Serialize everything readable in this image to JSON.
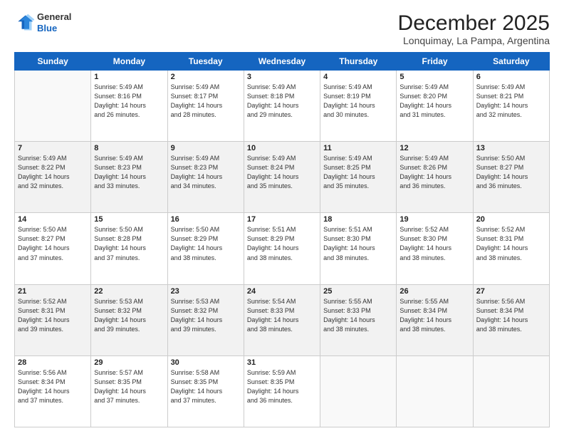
{
  "header": {
    "logo_line1": "General",
    "logo_line2": "Blue",
    "month_title": "December 2025",
    "location": "Lonquimay, La Pampa, Argentina"
  },
  "days_of_week": [
    "Sunday",
    "Monday",
    "Tuesday",
    "Wednesday",
    "Thursday",
    "Friday",
    "Saturday"
  ],
  "weeks": [
    [
      {
        "day": "",
        "info": ""
      },
      {
        "day": "1",
        "info": "Sunrise: 5:49 AM\nSunset: 8:16 PM\nDaylight: 14 hours\nand 26 minutes."
      },
      {
        "day": "2",
        "info": "Sunrise: 5:49 AM\nSunset: 8:17 PM\nDaylight: 14 hours\nand 28 minutes."
      },
      {
        "day": "3",
        "info": "Sunrise: 5:49 AM\nSunset: 8:18 PM\nDaylight: 14 hours\nand 29 minutes."
      },
      {
        "day": "4",
        "info": "Sunrise: 5:49 AM\nSunset: 8:19 PM\nDaylight: 14 hours\nand 30 minutes."
      },
      {
        "day": "5",
        "info": "Sunrise: 5:49 AM\nSunset: 8:20 PM\nDaylight: 14 hours\nand 31 minutes."
      },
      {
        "day": "6",
        "info": "Sunrise: 5:49 AM\nSunset: 8:21 PM\nDaylight: 14 hours\nand 32 minutes."
      }
    ],
    [
      {
        "day": "7",
        "info": "Sunrise: 5:49 AM\nSunset: 8:22 PM\nDaylight: 14 hours\nand 32 minutes."
      },
      {
        "day": "8",
        "info": "Sunrise: 5:49 AM\nSunset: 8:23 PM\nDaylight: 14 hours\nand 33 minutes."
      },
      {
        "day": "9",
        "info": "Sunrise: 5:49 AM\nSunset: 8:23 PM\nDaylight: 14 hours\nand 34 minutes."
      },
      {
        "day": "10",
        "info": "Sunrise: 5:49 AM\nSunset: 8:24 PM\nDaylight: 14 hours\nand 35 minutes."
      },
      {
        "day": "11",
        "info": "Sunrise: 5:49 AM\nSunset: 8:25 PM\nDaylight: 14 hours\nand 35 minutes."
      },
      {
        "day": "12",
        "info": "Sunrise: 5:49 AM\nSunset: 8:26 PM\nDaylight: 14 hours\nand 36 minutes."
      },
      {
        "day": "13",
        "info": "Sunrise: 5:50 AM\nSunset: 8:27 PM\nDaylight: 14 hours\nand 36 minutes."
      }
    ],
    [
      {
        "day": "14",
        "info": "Sunrise: 5:50 AM\nSunset: 8:27 PM\nDaylight: 14 hours\nand 37 minutes."
      },
      {
        "day": "15",
        "info": "Sunrise: 5:50 AM\nSunset: 8:28 PM\nDaylight: 14 hours\nand 37 minutes."
      },
      {
        "day": "16",
        "info": "Sunrise: 5:50 AM\nSunset: 8:29 PM\nDaylight: 14 hours\nand 38 minutes."
      },
      {
        "day": "17",
        "info": "Sunrise: 5:51 AM\nSunset: 8:29 PM\nDaylight: 14 hours\nand 38 minutes."
      },
      {
        "day": "18",
        "info": "Sunrise: 5:51 AM\nSunset: 8:30 PM\nDaylight: 14 hours\nand 38 minutes."
      },
      {
        "day": "19",
        "info": "Sunrise: 5:52 AM\nSunset: 8:30 PM\nDaylight: 14 hours\nand 38 minutes."
      },
      {
        "day": "20",
        "info": "Sunrise: 5:52 AM\nSunset: 8:31 PM\nDaylight: 14 hours\nand 38 minutes."
      }
    ],
    [
      {
        "day": "21",
        "info": "Sunrise: 5:52 AM\nSunset: 8:31 PM\nDaylight: 14 hours\nand 39 minutes."
      },
      {
        "day": "22",
        "info": "Sunrise: 5:53 AM\nSunset: 8:32 PM\nDaylight: 14 hours\nand 39 minutes."
      },
      {
        "day": "23",
        "info": "Sunrise: 5:53 AM\nSunset: 8:32 PM\nDaylight: 14 hours\nand 39 minutes."
      },
      {
        "day": "24",
        "info": "Sunrise: 5:54 AM\nSunset: 8:33 PM\nDaylight: 14 hours\nand 38 minutes."
      },
      {
        "day": "25",
        "info": "Sunrise: 5:55 AM\nSunset: 8:33 PM\nDaylight: 14 hours\nand 38 minutes."
      },
      {
        "day": "26",
        "info": "Sunrise: 5:55 AM\nSunset: 8:34 PM\nDaylight: 14 hours\nand 38 minutes."
      },
      {
        "day": "27",
        "info": "Sunrise: 5:56 AM\nSunset: 8:34 PM\nDaylight: 14 hours\nand 38 minutes."
      }
    ],
    [
      {
        "day": "28",
        "info": "Sunrise: 5:56 AM\nSunset: 8:34 PM\nDaylight: 14 hours\nand 37 minutes."
      },
      {
        "day": "29",
        "info": "Sunrise: 5:57 AM\nSunset: 8:35 PM\nDaylight: 14 hours\nand 37 minutes."
      },
      {
        "day": "30",
        "info": "Sunrise: 5:58 AM\nSunset: 8:35 PM\nDaylight: 14 hours\nand 37 minutes."
      },
      {
        "day": "31",
        "info": "Sunrise: 5:59 AM\nSunset: 8:35 PM\nDaylight: 14 hours\nand 36 minutes."
      },
      {
        "day": "",
        "info": ""
      },
      {
        "day": "",
        "info": ""
      },
      {
        "day": "",
        "info": ""
      }
    ]
  ]
}
